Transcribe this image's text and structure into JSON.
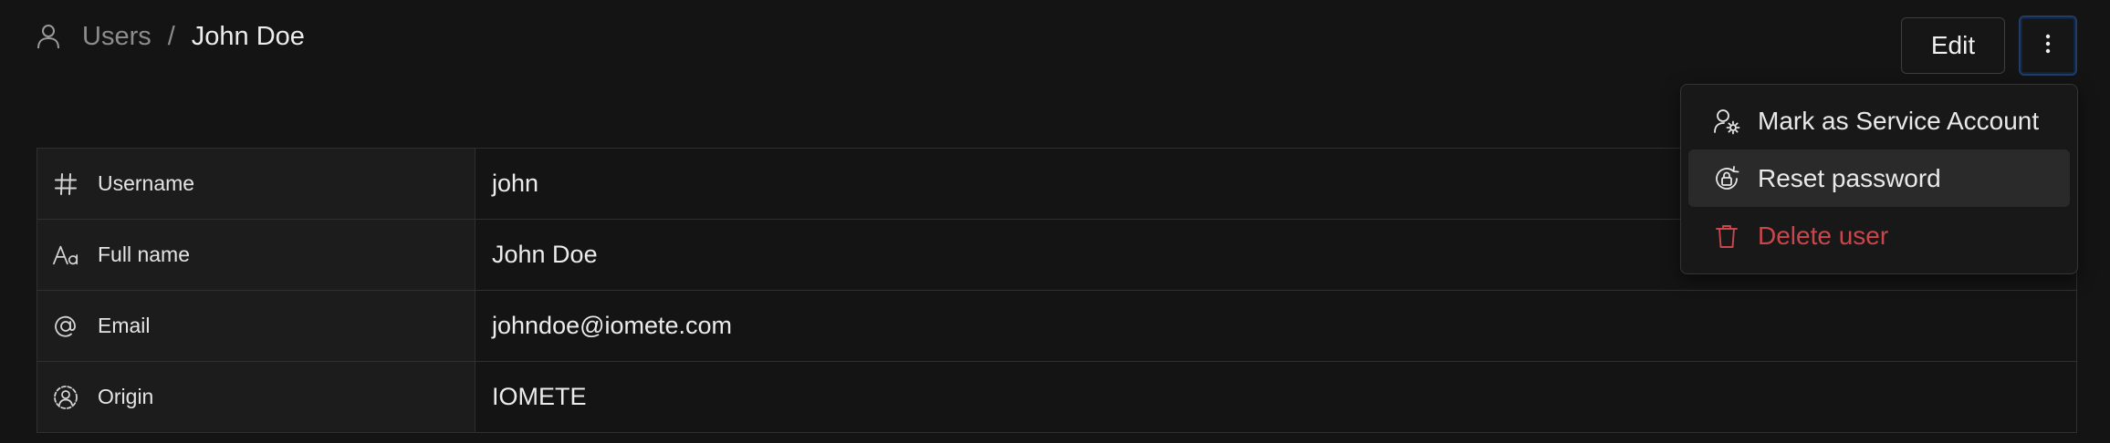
{
  "breadcrumb": {
    "icon": "user-icon",
    "parent": "Users",
    "separator": "/",
    "current": "John Doe"
  },
  "header": {
    "edit_label": "Edit",
    "more_icon": "more-vertical-icon"
  },
  "details": {
    "rows": [
      {
        "icon": "hash-icon",
        "label": "Username",
        "value": "john"
      },
      {
        "icon": "font-size-icon",
        "label": "Full name",
        "value": "John Doe"
      },
      {
        "icon": "at-sign-icon",
        "label": "Email",
        "value": "johndoe@iomete.com"
      },
      {
        "icon": "user-circle-icon",
        "label": "Origin",
        "value": "IOMETE"
      }
    ]
  },
  "menu": {
    "items": [
      {
        "icon": "user-cog-icon",
        "label": "Mark as Service Account"
      },
      {
        "icon": "lock-reset-icon",
        "label": "Reset password"
      },
      {
        "icon": "trash-icon",
        "label": "Delete user"
      }
    ],
    "danger_color": "#c8474d"
  }
}
